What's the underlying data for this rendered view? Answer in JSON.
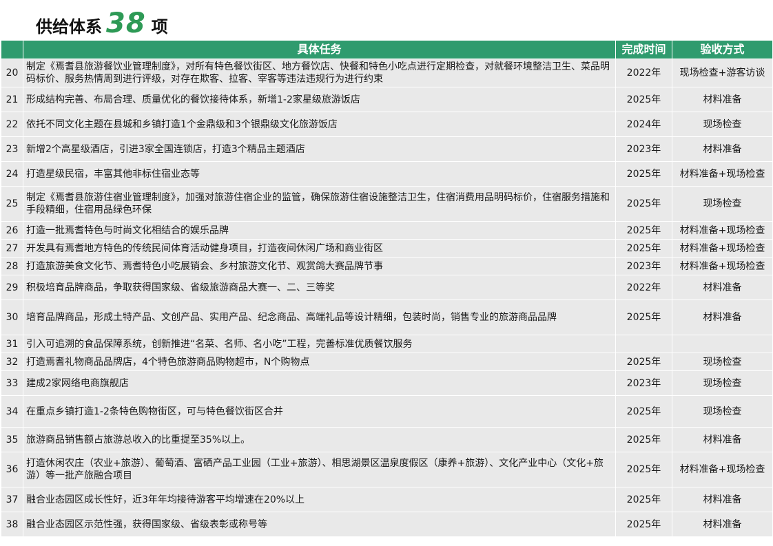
{
  "title": {
    "prefix": "供给体系",
    "number": "38",
    "suffix": "项"
  },
  "table": {
    "headers": {
      "num": "",
      "task": "具体任务",
      "time": "完成时间",
      "method": "验收方式"
    },
    "rows": [
      {
        "num": "20",
        "task": "制定《焉耆县旅游餐饮业管理制度》，对所有特色餐饮街区、地方餐饮店、快餐和特色小吃点进行定期检查，对就餐环境整洁卫生、菜品明码标价、服务热情周到进行评级，对存在欺客、拉客、宰客等违法违规行为进行约束",
        "time": "2022年",
        "method": "现场检查+游客访谈"
      },
      {
        "num": "21",
        "task": "形成结构完善、布局合理、质量优化的餐饮接待体系，新增1-2家星级旅游饭店",
        "time": "2025年",
        "method": "材料准备"
      },
      {
        "num": "22",
        "task": "依托不同文化主题在县城和乡镇打造1个金鼎级和3个银鼎级文化旅游饭店",
        "time": "2024年",
        "method": "现场检查"
      },
      {
        "num": "23",
        "task": "新增2个高星级酒店，引进3家全国连锁店，打造3个精品主题酒店",
        "time": "2023年",
        "method": "材料准备"
      },
      {
        "num": "24",
        "task": "打造星级民宿，丰富其他非标住宿业态等",
        "time": "2025年",
        "method": "材料准备+现场检查"
      },
      {
        "num": "25",
        "task": "制定《焉耆县旅游住宿业管理制度》，加强对旅游住宿企业的监管，确保旅游住宿设施整洁卫生，住宿消费用品明码标价，住宿服务措施和手段精细，住宿用品绿色环保",
        "time": "2025年",
        "method": "现场检查"
      },
      {
        "num": "26",
        "task": "打造一批焉耆特色与时尚文化相结合的娱乐品牌",
        "time": "2025年",
        "method": "材料准备+现场检查"
      },
      {
        "num": "27",
        "task": "开发具有焉耆地方特色的传统民间体育活动健身项目，打造夜间休闲广场和商业街区",
        "time": "2025年",
        "method": "材料准备+现场检查"
      },
      {
        "num": "28",
        "task": "打造旅游美食文化节、焉耆特色小吃展销会、乡村旅游文化节、观赏鸽大赛品牌节事",
        "time": "2023年",
        "method": "材料准备+现场检查"
      },
      {
        "num": "29",
        "task": "积极培育品牌商品，争取获得国家级、省级旅游商品大赛一、二、三等奖",
        "time": "2022年",
        "method": "材料准备"
      },
      {
        "num": "30",
        "task": "培育品牌商品，形成土特产品、文创产品、实用产品、纪念商品、高端礼品等设计精细，包装时尚，销售专业的旅游商品品牌",
        "time": "2025年",
        "method": "材料准备"
      },
      {
        "num": "31",
        "task": "引入可追溯的食品保障系统，创新推进“名菜、名师、名小吃”工程，完善标准优质餐饮服务",
        "time": "",
        "method": ""
      },
      {
        "num": "32",
        "task": "打造焉耆礼物商品品牌店，4个特色旅游商品购物超市，N个购物点",
        "time": "2025年",
        "method": "现场检查"
      },
      {
        "num": "33",
        "task": "建成2家网络电商旗舰店",
        "time": "2023年",
        "method": "现场检查"
      },
      {
        "num": "34",
        "task": "在重点乡镇打造1-2条特色购物街区，可与特色餐饮街区合并",
        "time": "2025年",
        "method": "现场检查"
      },
      {
        "num": "35",
        "task": "旅游商品销售额占旅游总收入的比重提至35%以上。",
        "time": "2025年",
        "method": "材料准备"
      },
      {
        "num": "36",
        "task": "打造休闲农庄（农业+旅游）、葡萄酒、富硒产品工业园（工业+旅游）、相思湖景区温泉度假区（康养+旅游）、文化产业中心（文化+旅游）等一批产旅融合项目",
        "time": "2025年",
        "method": "材料准备+现场检查"
      },
      {
        "num": "37",
        "task": "融合业态园区成长性好，近3年年均接待游客平均增速在20%以上",
        "time": "2025年",
        "method": "材料准备"
      },
      {
        "num": "38",
        "task": "融合业态园区示范性强，获得国家级、省级表彰或称号等",
        "time": "2025年",
        "method": "材料准备"
      }
    ]
  }
}
